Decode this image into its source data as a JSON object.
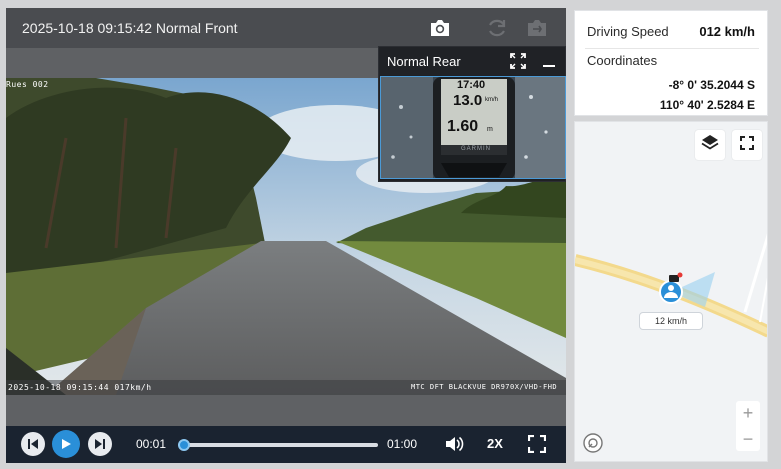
{
  "video": {
    "title": "2025-10-18 09:15:42 Normal Front",
    "front_overlay_left": "Rues 002",
    "front_overlay_bottom_left": "2025-10-18 09:15:44 017km/h",
    "front_overlay_bottom_right": "MTC DFT BLACKVUE DR970X/VHD-FHD",
    "rear_title": "Normal Rear",
    "gps_display": {
      "top": "17:40",
      "mid": "13.0",
      "mid_unit": "km/h",
      "low": "1.60",
      "low_unit": "m",
      "brand": "GARMIN"
    }
  },
  "player": {
    "current_time": "00:01",
    "duration": "01:00",
    "progress": 0.017,
    "speed": "2X"
  },
  "info": {
    "speed_label": "Driving Speed",
    "speed_value": "012 km/h",
    "coords_label": "Coordinates",
    "lat": "-8° 0' 35.2044 S",
    "lon": "110° 40' 2.5284 E"
  },
  "map": {
    "vehicle_speed": "12 km/h",
    "zoom_in": "+",
    "zoom_out": "−"
  },
  "colors": {
    "accent": "#2a8fd8",
    "control_bar": "#1a2330",
    "road": "#f3d98c"
  }
}
